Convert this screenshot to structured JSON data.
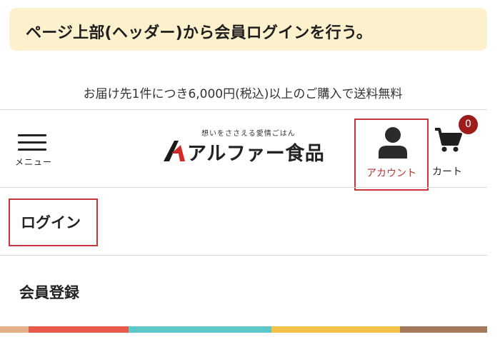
{
  "banner": {
    "text": "ページ上部(ヘッダー)から会員ログインを行う。"
  },
  "header": {
    "shipping_notice": "お届け先1件につき6,000円(税込)以上のご購入で送料無料",
    "menu": {
      "label": "メニュー",
      "icon": "hamburger-icon"
    },
    "logo": {
      "tagline": "想いをささえる愛情ごはん",
      "name": "アルファー食品",
      "icon": "alpha-logo-mark"
    },
    "account": {
      "label": "アカウント",
      "icon": "user-icon"
    },
    "cart": {
      "label": "カート",
      "count": "0",
      "icon": "cart-icon"
    }
  },
  "menu_list": {
    "login": "ログイン",
    "register": "会員登録"
  },
  "colors": {
    "banner_bg": "#fdf0cc",
    "highlight": "#c8353b",
    "account_label": "#b6372e",
    "cart_badge": "#9c1c1c"
  }
}
